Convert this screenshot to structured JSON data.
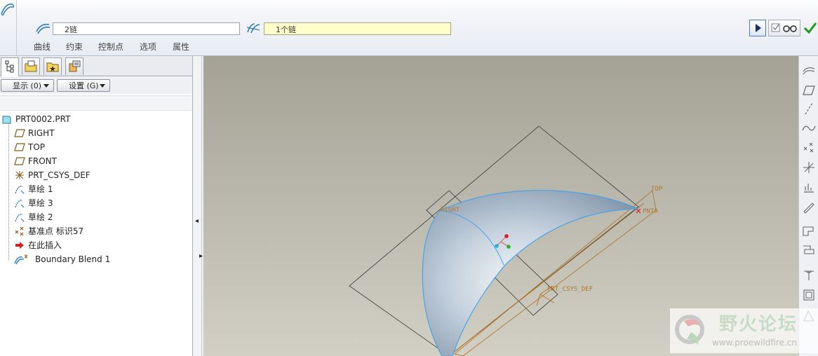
{
  "dashboard": {
    "collectors": [
      {
        "text": "2链",
        "icon": "curves-collector-icon"
      },
      {
        "text": "1个链",
        "icon": "cross-curves-collector-icon"
      }
    ],
    "tabs": [
      "曲线",
      "约束",
      "控制点",
      "选项",
      "属性"
    ],
    "buttons": {
      "pause": "play-resume-icon",
      "preview": "verify-preview-icon",
      "ok": "checkmark-icon"
    },
    "colors": {
      "active_collector": "#ffffcc",
      "ok_green": "#1a9a1a"
    }
  },
  "panel": {
    "tabs": [
      "model-tree-tab",
      "folder-browser-tab",
      "favorites-tab",
      "connections-tab"
    ],
    "show_button": "显示 (0)",
    "settings_button": "设置 (G)",
    "tree": [
      {
        "label": "PRT0002.PRT",
        "icon": "part-icon"
      },
      {
        "label": "RIGHT",
        "icon": "datum-plane-icon"
      },
      {
        "label": "TOP",
        "icon": "datum-plane-icon"
      },
      {
        "label": "FRONT",
        "icon": "datum-plane-icon"
      },
      {
        "label": "PRT_CSYS_DEF",
        "icon": "csys-icon"
      },
      {
        "label": "草绘 1",
        "icon": "sketch-icon"
      },
      {
        "label": "草绘 3",
        "icon": "sketch-icon"
      },
      {
        "label": "草绘 2",
        "icon": "sketch-icon"
      },
      {
        "label": "基准点 标识57",
        "icon": "datum-point-icon"
      },
      {
        "label": "在此插入",
        "icon": "insert-here-arrow-icon"
      },
      {
        "label": "Boundary Blend 1",
        "icon": "boundary-blend-icon"
      }
    ]
  },
  "viewport": {
    "labels": {
      "right": "RIGHT",
      "top": "TOP",
      "point": "PNT0",
      "csys": "PRT_CSYS_DEF"
    },
    "colors": {
      "background_top": "#a4a295",
      "background_bottom": "#d2d0c5",
      "datum_orange": "#b0782a",
      "surface_edge": "#4aa3e8"
    }
  },
  "right_toolbar": [
    "boundary-blend-tool-icon",
    "datum-plane-tool-icon",
    "datum-axis-tool-icon",
    "datum-curve-tool-icon",
    "datum-point-tool-icon",
    "csys-tool-icon",
    "analysis-tool-icon",
    "sketch-tool-icon",
    "extrude-tool-icon",
    "revolve-tool-icon",
    "round-tool-icon",
    "shell-tool-icon",
    "draft-tool-icon"
  ],
  "watermark": {
    "title": "野火论坛",
    "url": "www.proewildfire.cn"
  }
}
